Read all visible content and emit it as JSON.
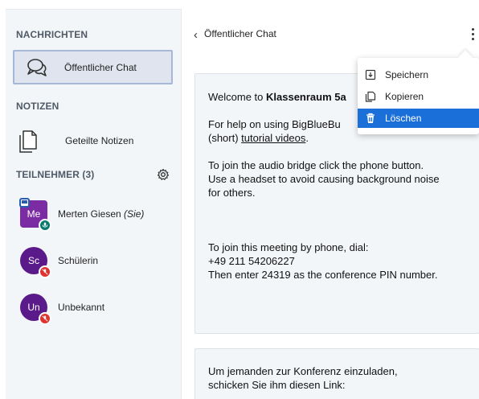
{
  "sidebar": {
    "messages_title": "NACHRICHTEN",
    "public_chat_label": "Öffentlicher Chat",
    "notes_title": "NOTIZEN",
    "shared_notes_label": "Geteilte Notizen",
    "participants_title": "TEILNEHMER (3)",
    "users": [
      {
        "initials": "Me",
        "name": "Merten Giesen",
        "suffix": "(Sie)",
        "color": "#7b2ca3",
        "status": "presenter-voice"
      },
      {
        "initials": "Sc",
        "name": "Schülerin",
        "suffix": "",
        "color": "#5b1a8a",
        "status": "muted"
      },
      {
        "initials": "Un",
        "name": "Unbekannt",
        "suffix": "",
        "color": "#5b1a8a",
        "status": "muted"
      }
    ]
  },
  "chat": {
    "title": "Öffentlicher Chat",
    "welcome": {
      "line1_prefix": "Welcome to ",
      "line1_bold": "Klassenraum 5a",
      "line2": "For help on using BigBlueBu",
      "line3_prefix": "(short) ",
      "line3_link": "tutorial videos",
      "line3_suffix": ".",
      "line4": "To join the audio bridge click the phone button.",
      "line5": "Use a headset to avoid causing background noise",
      "line6": "for others.",
      "line7": "To join this meeting by phone, dial:",
      "line8": "+49 211 54206227",
      "line9": "Then enter 24319 as the conference PIN number."
    },
    "invite": {
      "line1": "Um jemanden zur Konferenz einzuladen,",
      "line2": "schicken Sie ihm diesen Link:"
    }
  },
  "menu": {
    "items": [
      {
        "label": "Speichern",
        "icon": "save-icon"
      },
      {
        "label": "Kopieren",
        "icon": "copy-icon"
      },
      {
        "label": "Löschen",
        "icon": "trash-icon"
      }
    ]
  },
  "colors": {
    "accent": "#1b6fd8",
    "sidebar_bg": "#f3f6f9",
    "selected_bg": "#dfe4ee",
    "muted_badge": "#e0322e",
    "voice_badge": "#0b7a6e"
  }
}
